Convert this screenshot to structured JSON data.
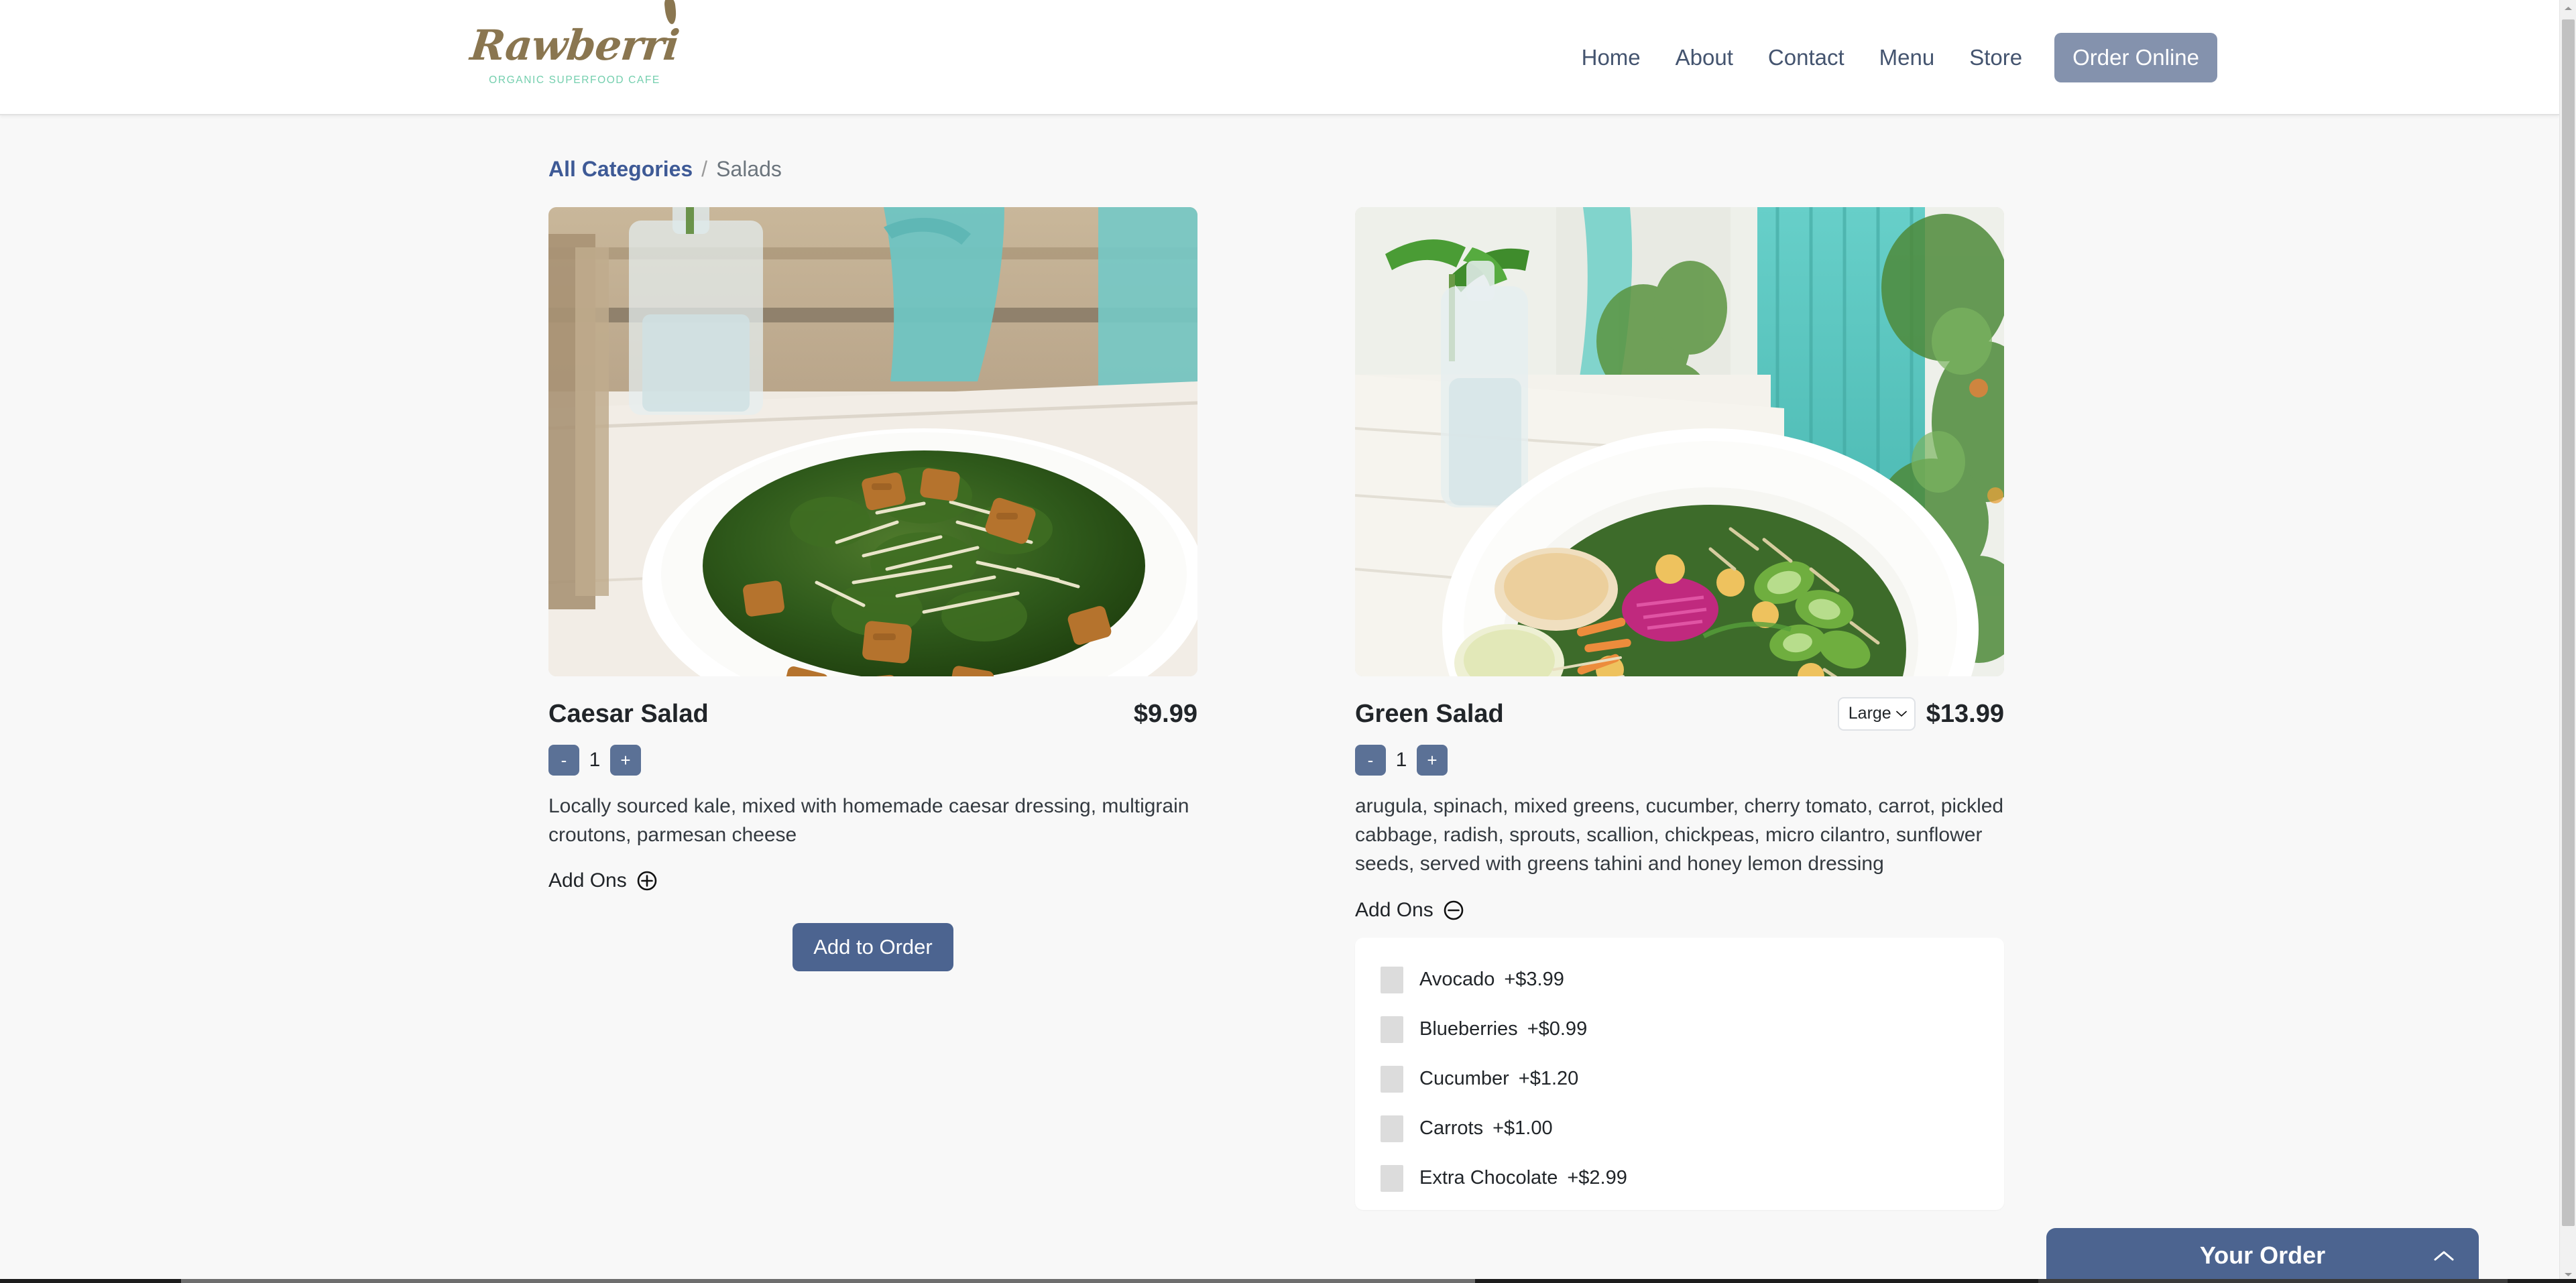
{
  "header": {
    "brand": {
      "wordmark": "Rawberri",
      "tagline": "ORGANIC SUPERFOOD CAFE",
      "wordmark_color": "#8a7650",
      "tagline_color": "#74cfae"
    },
    "nav": [
      {
        "label": "Home"
      },
      {
        "label": "About"
      },
      {
        "label": "Contact"
      },
      {
        "label": "Menu"
      },
      {
        "label": "Store"
      }
    ],
    "cta": {
      "label": "Order Online",
      "bg": "#8492ad",
      "color": "#ffffff"
    }
  },
  "breadcrumb": {
    "root": "All Categories",
    "separator": "/",
    "current": "Salads",
    "link_color": "#3e5a96"
  },
  "items": [
    {
      "name": "Caesar Salad",
      "price": "$9.99",
      "has_size_select": false,
      "quantity": "1",
      "minus_label": "-",
      "plus_label": "+",
      "description": "Locally sourced kale, mixed with homemade caesar dressing, multigrain croutons, parmesan cheese",
      "addons_label": "Add Ons",
      "addons_expanded": false,
      "addons_icon": "plus-circle-icon",
      "addons": [],
      "add_to_order_label": "Add to Order",
      "show_add_to_order": true,
      "photo_alt": "caesar-kale-salad-on-white-plate"
    },
    {
      "name": "Green Salad",
      "price": "$13.99",
      "has_size_select": true,
      "size_selected": "Large",
      "size_options": [
        "Large"
      ],
      "quantity": "1",
      "minus_label": "-",
      "plus_label": "+",
      "description": "arugula, spinach, mixed greens, cucumber, cherry tomato, carrot, pickled cabbage, radish, sprouts, scallion, chickpeas, micro cilantro, sunflower seeds, served with greens tahini and honey lemon dressing",
      "addons_label": "Add Ons",
      "addons_expanded": true,
      "addons_icon": "minus-circle-icon",
      "addons": [
        {
          "label": "Avocado",
          "price": "+$3.99",
          "checked": false
        },
        {
          "label": "Blueberries",
          "price": "+$0.99",
          "checked": false
        },
        {
          "label": "Cucumber",
          "price": "+$1.20",
          "checked": false
        },
        {
          "label": "Carrots",
          "price": "+$1.00",
          "checked": false
        },
        {
          "label": "Extra Chocolate",
          "price": "+$2.99",
          "checked": false
        }
      ],
      "add_to_order_label": "Add to Order",
      "show_add_to_order": false,
      "photo_alt": "green-salad-bowl-with-vegetables"
    }
  ],
  "order_bar": {
    "title": "Your Order",
    "chevron": "chevron-up-icon",
    "bg": "#4c6490"
  },
  "theme": {
    "page_bg": "#f8f8f8",
    "accent": "#4c6490",
    "stepper": "#5b7196",
    "text": "#212529"
  }
}
